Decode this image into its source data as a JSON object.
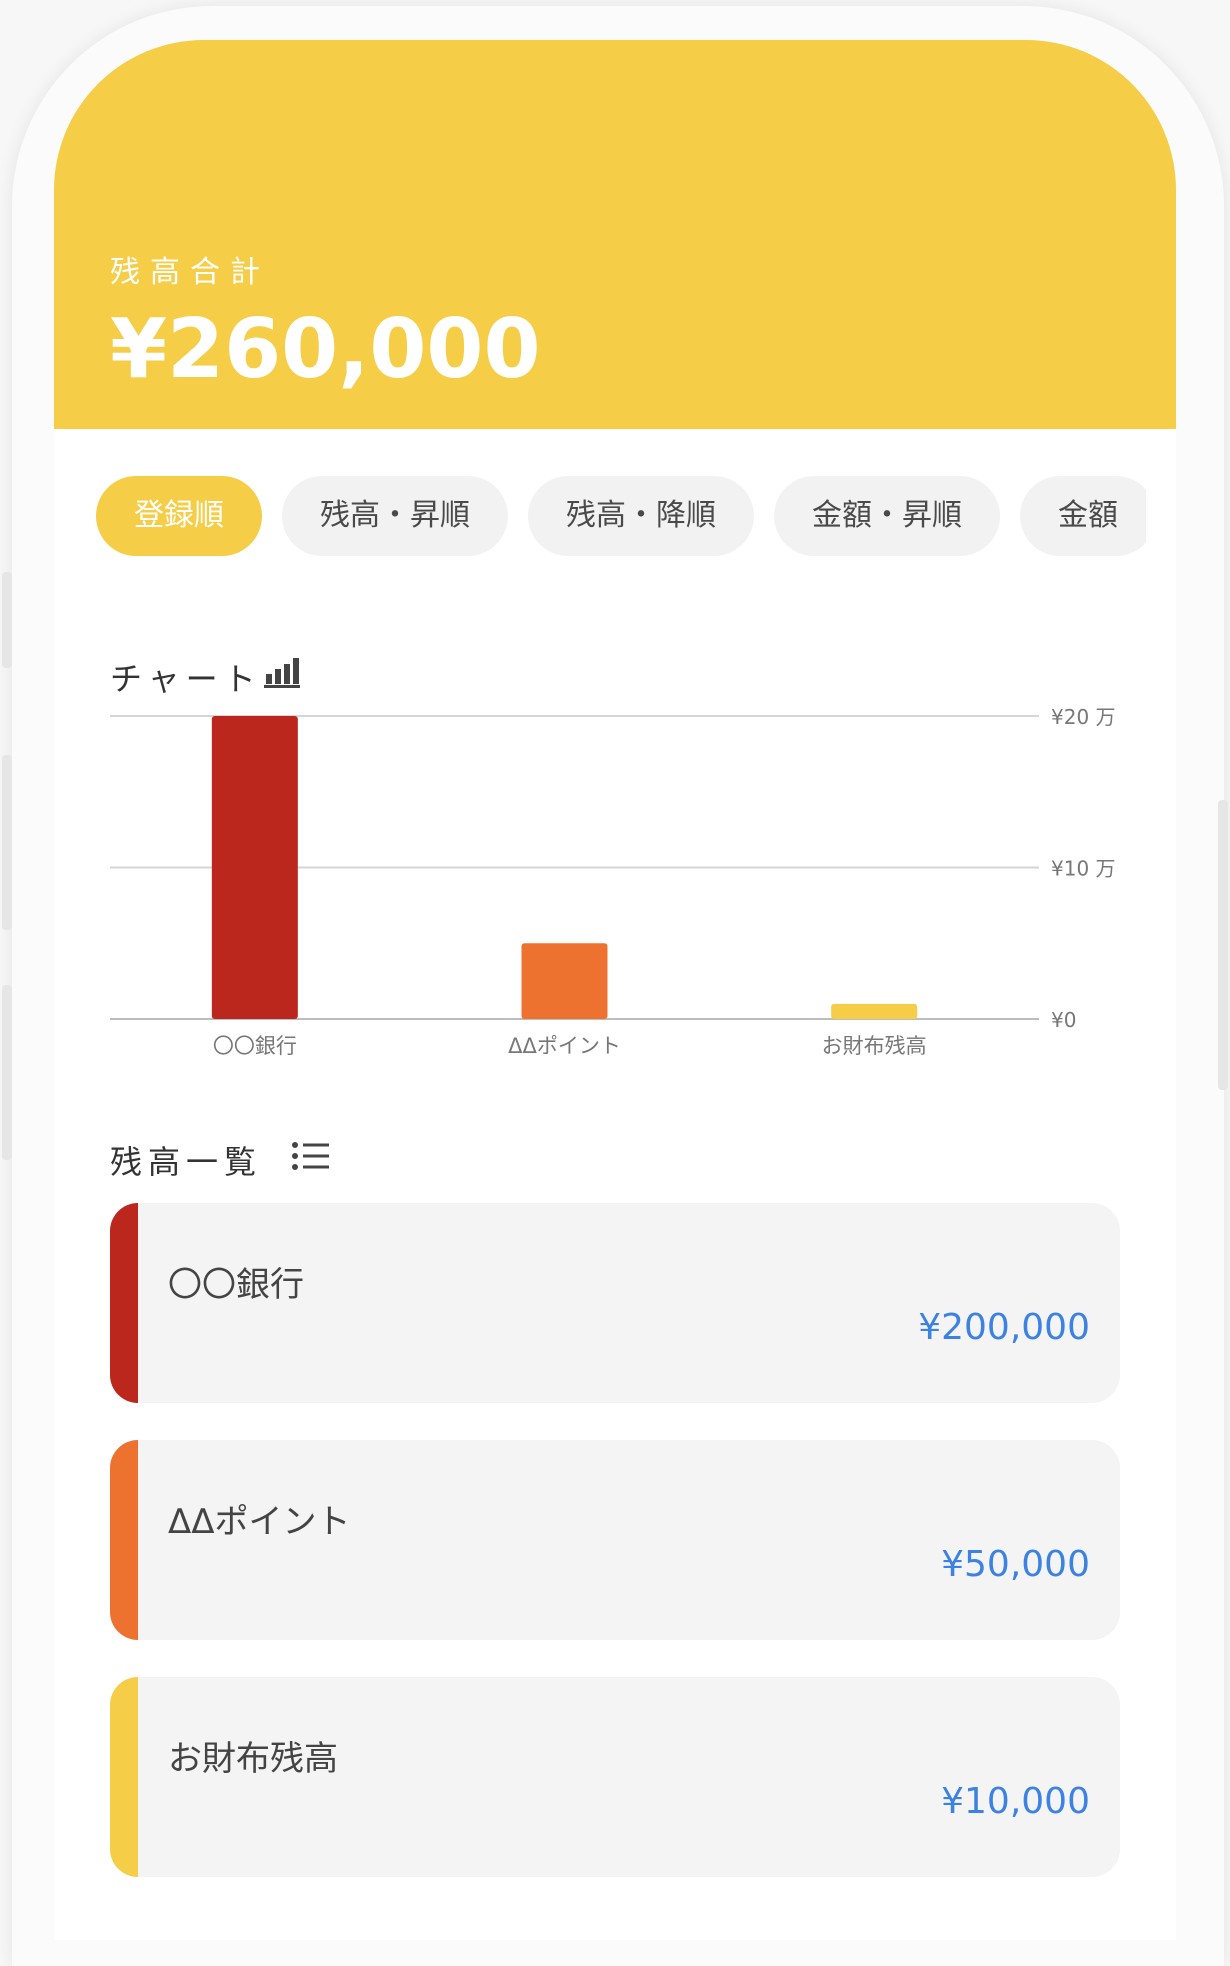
{
  "summary": {
    "label": "残高合計",
    "total": "¥260,000"
  },
  "sort_tabs": [
    {
      "label": "登録順",
      "active": true
    },
    {
      "label": "残高・昇順",
      "active": false
    },
    {
      "label": "残高・降順",
      "active": false
    },
    {
      "label": "金額・昇順",
      "active": false
    },
    {
      "label": "金額",
      "active": false
    }
  ],
  "chart_section": {
    "title": "チャート",
    "icon": "bar-chart-icon"
  },
  "chart_data": {
    "type": "bar",
    "categories": [
      "〇〇銀行",
      "ΔΔポイント",
      "お財布残高"
    ],
    "values": [
      200000,
      50000,
      10000
    ],
    "colors": [
      "#bb271d",
      "#ee722f",
      "#f5cd47"
    ],
    "ylim": [
      0,
      200000
    ],
    "yticks": [
      {
        "value": 200000,
        "label": "¥20 万"
      },
      {
        "value": 100000,
        "label": "¥10 万"
      },
      {
        "value": 0,
        "label": "¥0"
      }
    ],
    "grid": true
  },
  "list_section": {
    "title": "残高一覧",
    "icon": "list-icon"
  },
  "accounts": [
    {
      "name": "〇〇銀行",
      "amount": "¥200,000",
      "color": "#bb271d"
    },
    {
      "name": "ΔΔポイント",
      "amount": "¥50,000",
      "color": "#ee722f"
    },
    {
      "name": "お財布残高",
      "amount": "¥10,000",
      "color": "#f5cd47"
    }
  ],
  "colors": {
    "brand": "#f5cd47",
    "amount_text": "#3b82e3"
  }
}
